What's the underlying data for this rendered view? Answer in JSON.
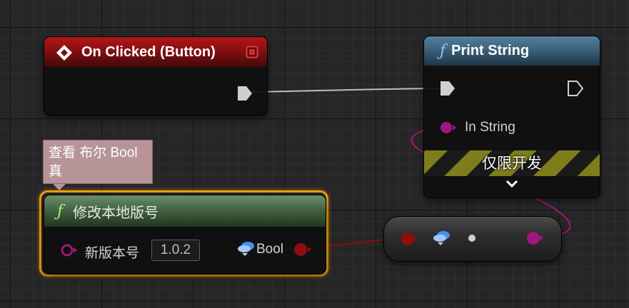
{
  "nodes": {
    "on_clicked": {
      "title": "On Clicked (Button)"
    },
    "print_string": {
      "title": "Print String",
      "in_string_label": "In String",
      "dev_only_label": "仅限开发"
    },
    "modify_version": {
      "title": "修改本地版号",
      "input_label": "新版本号",
      "input_value": "1.0.2",
      "output_label": "Bool"
    }
  },
  "tooltip": {
    "line1": "查看 布尔 Bool",
    "line2": "真"
  },
  "icons": [
    "event-diamond-icon",
    "stop-square-icon",
    "function-f-icon",
    "exec-pin-icon",
    "data-pin-icon",
    "bool-type-icon",
    "chevron-down-icon"
  ],
  "colors": {
    "event_header": "#b4161a",
    "function_header_print": "#56809e",
    "function_header_custom": "#6a8f6a",
    "bool_pin": "#8f0c10",
    "string_pin": "#a0167a",
    "selection_outline": "#f2a010",
    "dev_only_stripe": "#7e7d1c"
  }
}
